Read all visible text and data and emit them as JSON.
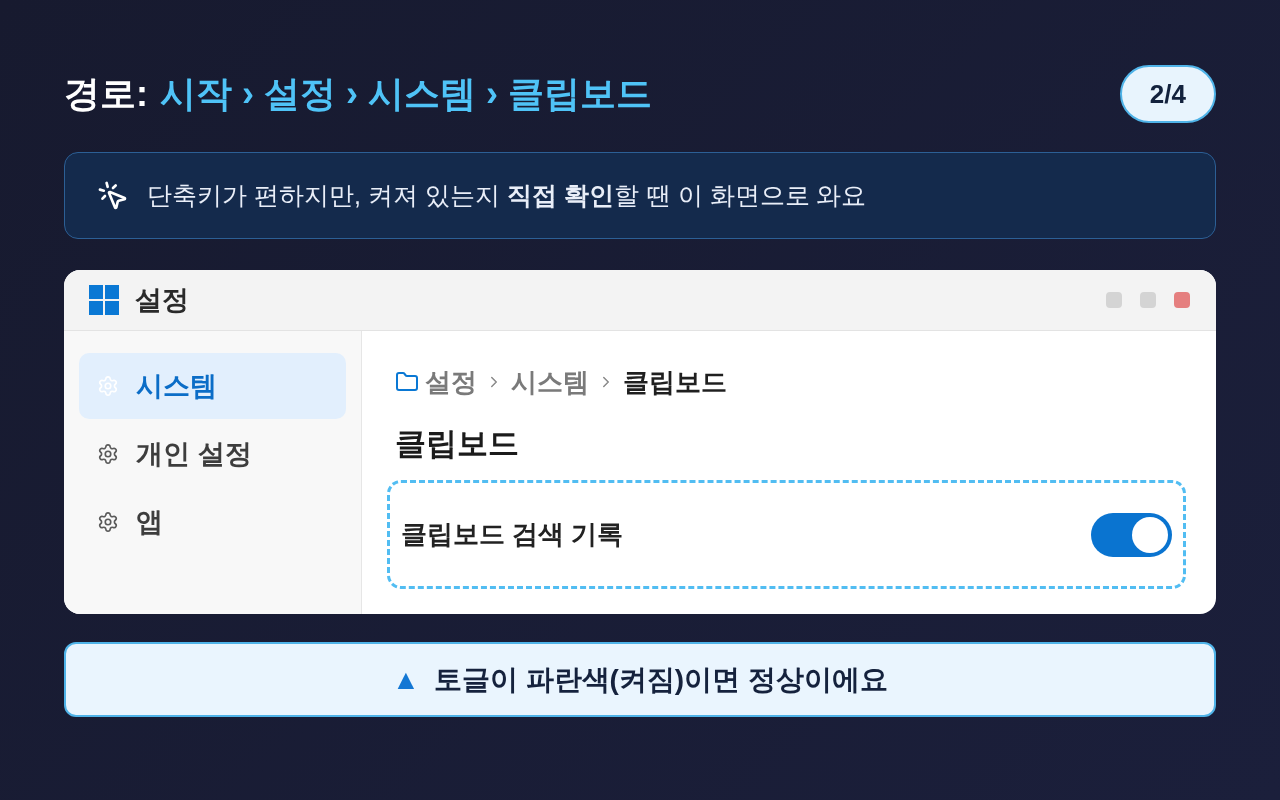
{
  "header": {
    "label": "경로:",
    "path": "시작 › 설정 › 시스템 › 클립보드",
    "page": "2/4"
  },
  "tip": {
    "text": "단축키가 편하지만, 켜져 있는지 **직접 확인**할 땐 이 화면으로 와요"
  },
  "window": {
    "title": "설정",
    "controls": [
      {
        "color": "#d4d4d4"
      },
      {
        "color": "#d4d4d4"
      },
      {
        "color": "#e57f7f"
      }
    ]
  },
  "sidebar": {
    "items": [
      {
        "label": "시스템",
        "selected": true
      },
      {
        "label": "개인 설정",
        "selected": false
      },
      {
        "label": "앱",
        "selected": false
      }
    ]
  },
  "breadcrumb": {
    "items": [
      {
        "label": "설정",
        "current": false
      },
      {
        "label": "시스템",
        "current": false
      },
      {
        "label": "클립보드",
        "current": true
      }
    ]
  },
  "page_title": "클립보드",
  "setting": {
    "label": "클립보드 검색 기록",
    "on": true,
    "highlighted": true
  },
  "note": {
    "marker": "▲",
    "text": "토글이 파란색(켜짐)이면 정상이에요"
  }
}
